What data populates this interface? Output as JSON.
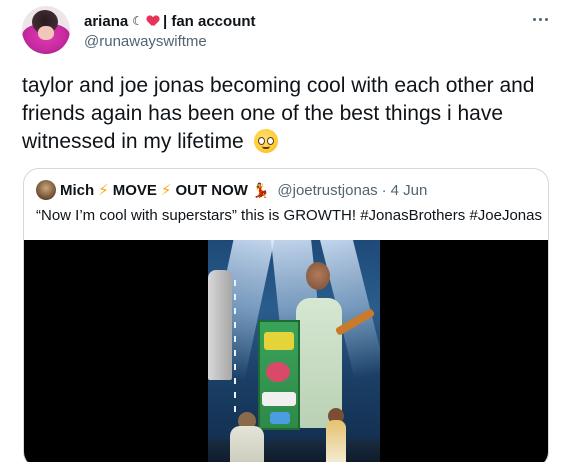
{
  "tweet": {
    "display_name": "ariana",
    "name_suffix": "| fan account",
    "handle": "@runawayswiftme",
    "text": "taylor and joe jonas becoming cool with each other and friends again has been one of the best things i have witnessed in my lifetime",
    "emoji_icon": "pleading-face-icon",
    "more_icon": "more-options-icon"
  },
  "quote": {
    "display_name_parts": [
      "Mich",
      "MOVE",
      "OUT NOW"
    ],
    "handle": "@joetrustjonas",
    "separator": "·",
    "date": "4 Jun",
    "text": "“Now I’m cool with superstars” this is GROWTH! #JonasBrothers #JoeJonas",
    "media": "concert-video"
  },
  "colors": {
    "text_primary": "#0f1419",
    "text_secondary": "#536471",
    "border": "#cfd9de",
    "bolt": "#f4a91a"
  }
}
